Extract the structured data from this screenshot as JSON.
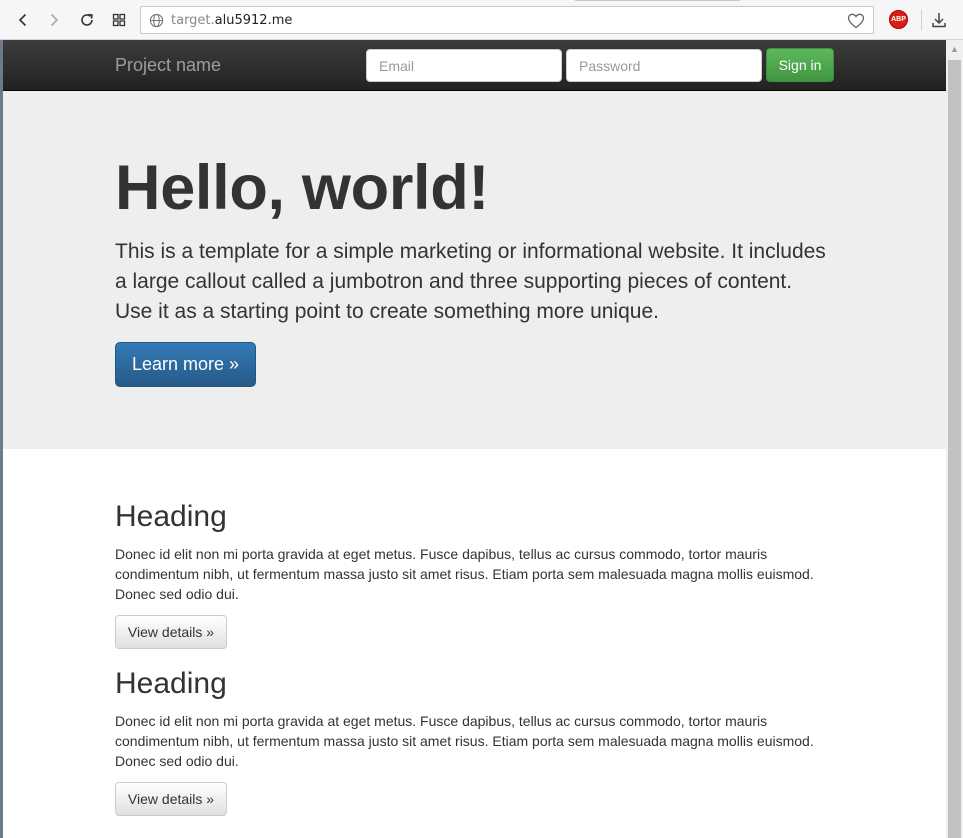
{
  "browser": {
    "url_host_dim": "target.",
    "url_host": "alu5912.me",
    "extension_label": "ABP"
  },
  "navbar": {
    "brand": "Project name",
    "email_placeholder": "Email",
    "password_placeholder": "Password",
    "signin_label": "Sign in"
  },
  "jumbotron": {
    "title": "Hello, world!",
    "text": "This is a template for a simple marketing or informational website. It includes a large callout called a jumbotron and three supporting pieces of content. Use it as a starting point to create something more unique.",
    "button_label": "Learn more »"
  },
  "sections": [
    {
      "heading": "Heading",
      "body": "Donec id elit non mi porta gravida at eget metus. Fusce dapibus, tellus ac cursus commodo, tortor mauris condimentum nibh, ut fermentum massa justo sit amet risus. Etiam porta sem malesuada magna mollis euismod. Donec sed odio dui.",
      "button_label": "View details »"
    },
    {
      "heading": "Heading",
      "body": "Donec id elit non mi porta gravida at eget metus. Fusce dapibus, tellus ac cursus commodo, tortor mauris condimentum nibh, ut fermentum massa justo sit amet risus. Etiam porta sem malesuada magna mollis euismod. Donec sed odio dui.",
      "button_label": "View details »"
    }
  ],
  "icons": [
    "back-icon",
    "forward-icon",
    "reload-icon",
    "speed-dial-icon",
    "globe-icon",
    "heart-icon",
    "adblock-icon",
    "download-icon"
  ],
  "colors": {
    "navbar": "#222222",
    "jumbotron": "#eeeeee",
    "primary_button": "#337ab7",
    "success_button": "#5cb85c"
  }
}
